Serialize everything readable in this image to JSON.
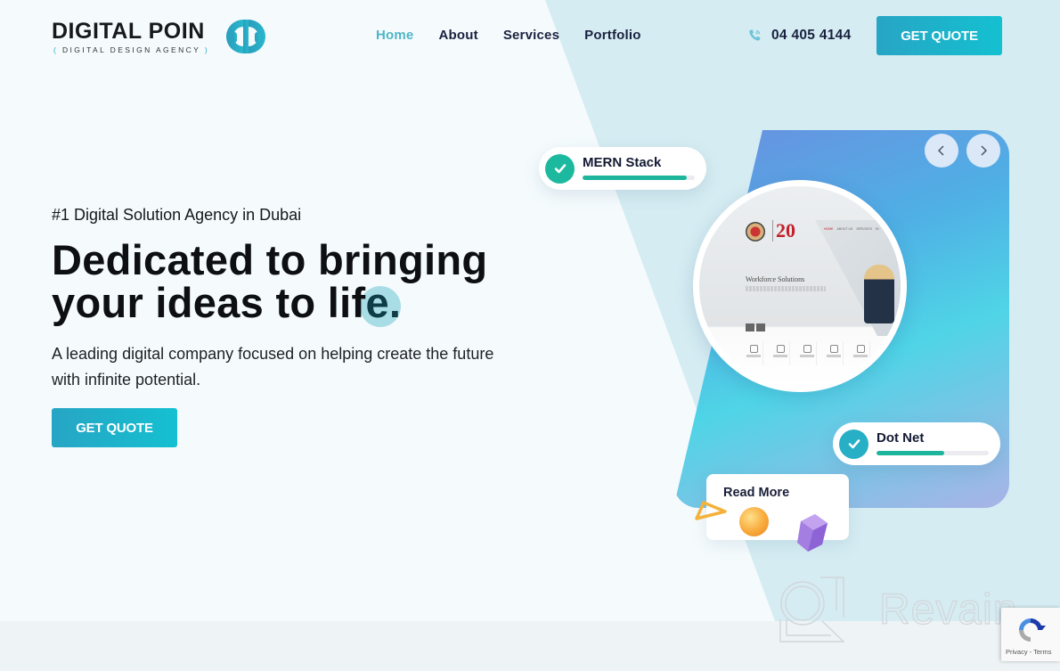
{
  "header": {
    "logo": {
      "title": "DIGITAL POIN",
      "subtitle_open": "(",
      "subtitle": "DIGITAL DESIGN AGENCY",
      "subtitle_close": ")"
    },
    "nav": [
      {
        "label": "Home",
        "active": true
      },
      {
        "label": "About",
        "active": false
      },
      {
        "label": "Services",
        "active": false
      },
      {
        "label": "Portfolio",
        "active": false
      }
    ],
    "phone": {
      "icon": "phone-icon",
      "number": "04 405 4144"
    },
    "cta_label": "GET QUOTE"
  },
  "hero": {
    "eyebrow": "#1 Digital Solution Agency in Dubai",
    "headline_line1": "Dedicated to bringing",
    "headline_line2_prefix": "your ideas to lif",
    "headline_line2_highlight": "e.",
    "lead": "A leading digital company focused on helping create the future with infinite potential.",
    "cta_label": "GET QUOTE"
  },
  "showcase": {
    "prev_icon": "chevron-left-icon",
    "next_icon": "chevron-right-icon",
    "mockup": {
      "badge_text": "20",
      "nav": [
        "HOME",
        "ABOUT US",
        "SERVICES",
        "IN"
      ],
      "title": "Workforce Solutions"
    },
    "skills": [
      {
        "label": "MERN Stack",
        "progress": 0.93,
        "icon": "check-icon"
      },
      {
        "label": "Dot Net",
        "progress": 0.6,
        "icon": "check-icon"
      }
    ],
    "read_more_label": "Read More"
  },
  "colors": {
    "accent": "#27a5c4",
    "accent_light": "#14c0d1",
    "nav_active": "#4fb5c7",
    "text_dark": "#1a2140",
    "progress_fill": "#1eb59d"
  },
  "watermark": {
    "text": "Revain"
  },
  "recaptcha": {
    "links": "Privacy - Terms"
  }
}
